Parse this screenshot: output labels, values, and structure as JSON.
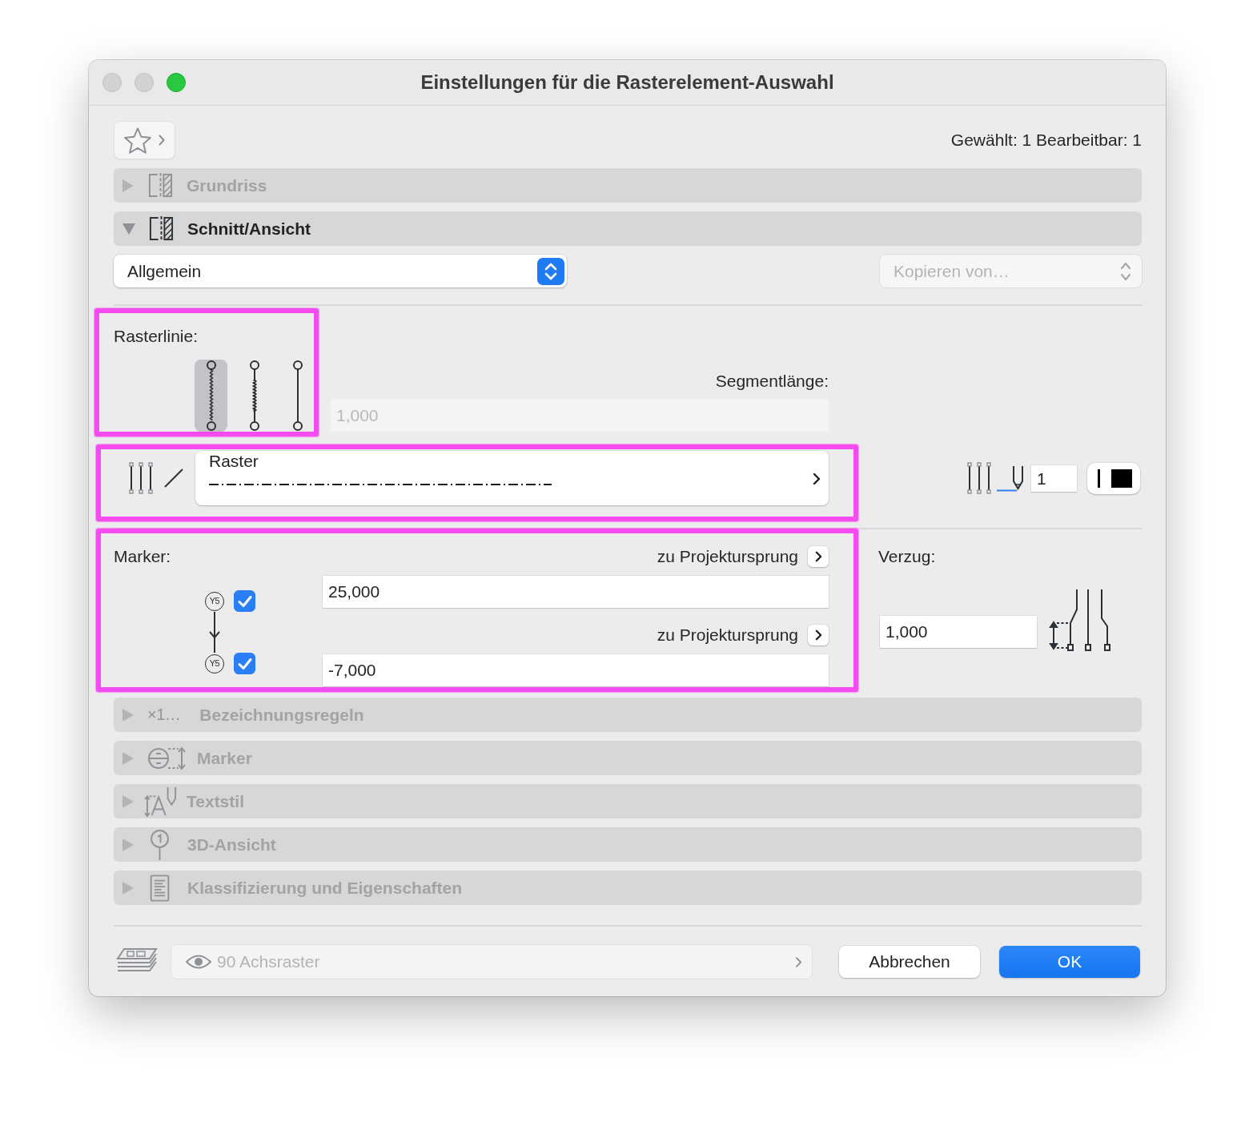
{
  "window": {
    "title": "Einstellungen für die Rasterelement-Auswahl",
    "controls": [
      {
        "kind": "close",
        "enabled": false
      },
      {
        "kind": "minimize",
        "enabled": false
      },
      {
        "kind": "zoom",
        "enabled": true
      }
    ]
  },
  "header": {
    "selection_info": "Gewählt: 1 Bearbeitbar: 1"
  },
  "panels": [
    {
      "kind": "floorplan",
      "title": "Grundriss",
      "expanded": false
    },
    {
      "kind": "section",
      "title": "Schnitt/Ansicht",
      "expanded": true
    },
    {
      "kind": "naming",
      "icon_text": "×1…",
      "title": "Bezeichnungsregeln",
      "expanded": false
    },
    {
      "kind": "marker",
      "title": "Marker",
      "expanded": false
    },
    {
      "kind": "textstyle",
      "title": "Textstil",
      "expanded": false
    },
    {
      "kind": "view3d",
      "title": "3D-Ansicht",
      "expanded": false
    },
    {
      "kind": "classification",
      "title": "Klassifizierung und Eigenschaften",
      "expanded": false
    }
  ],
  "section_view": {
    "category": {
      "value": "Allgemein"
    },
    "copy_from": {
      "label": "Kopieren von…",
      "disabled": true
    },
    "grid_line": {
      "label": "Rasterlinie:",
      "highlighted": true,
      "styles": [
        {
          "kind": "wavy",
          "selected": true
        },
        {
          "kind": "mixed",
          "selected": false
        },
        {
          "kind": "solid",
          "selected": false
        }
      ]
    },
    "segment_length": {
      "label": "Segmentlänge:",
      "value": "1,000",
      "disabled": true
    },
    "line_type": {
      "name": "Raster",
      "highlighted": true
    },
    "pen": {
      "value": "1"
    },
    "markers": {
      "label": "Marker:",
      "highlighted": true,
      "ends": [
        {
          "symbol": "Y5",
          "checked": true,
          "reference": "zu Projektursprung",
          "value": "25,000"
        },
        {
          "symbol": "Y5",
          "checked": true,
          "reference": "zu Projektursprung",
          "value": "-7,000"
        }
      ]
    },
    "offset": {
      "label": "Verzug:",
      "value": "1,000"
    }
  },
  "footer": {
    "layer_field": {
      "value": "90 Achsraster",
      "disabled": true
    },
    "buttons": [
      {
        "kind": "secondary",
        "label": "Abbrechen"
      },
      {
        "kind": "primary",
        "label": "OK"
      }
    ]
  }
}
